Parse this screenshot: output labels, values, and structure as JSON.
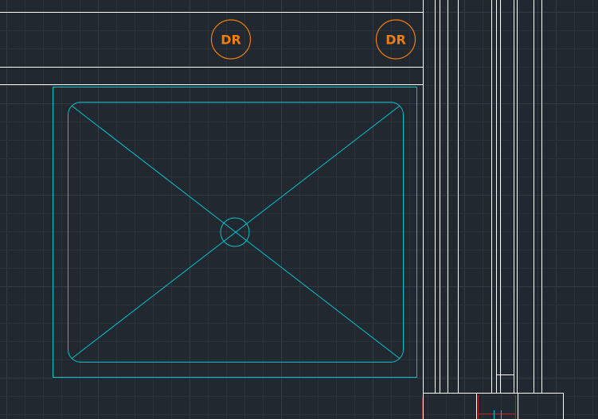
{
  "drawing": {
    "annotations": [
      {
        "text": "DR"
      },
      {
        "text": "DR"
      }
    ]
  },
  "colors": {
    "background": "#212830",
    "grid_minor": "#2a313a",
    "grid_major": "#323b46",
    "lines": "#ffffff",
    "shower": "#00c4cc",
    "tags": "#f07d0a",
    "hidden": "#b52020"
  },
  "icons": {
    "drain": "drain-symbol-icon",
    "tag": "dr-tag-icon"
  }
}
